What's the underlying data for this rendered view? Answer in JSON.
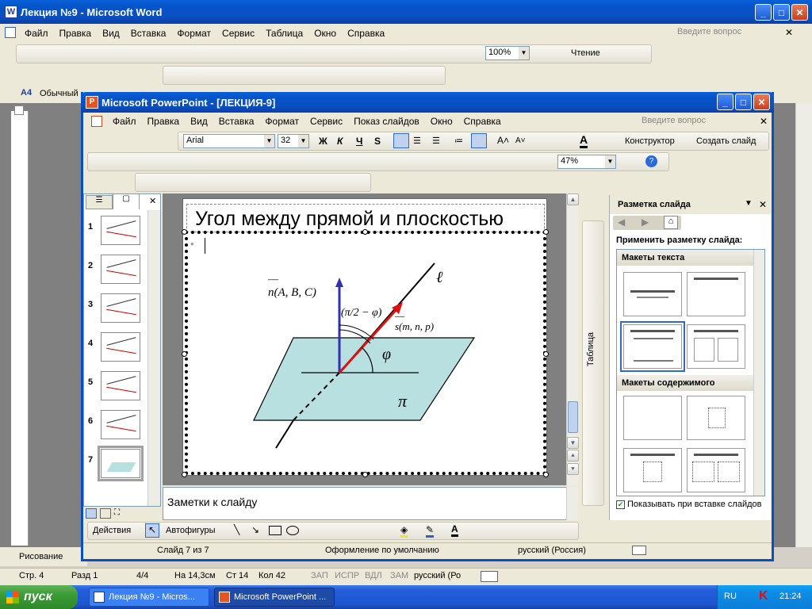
{
  "word": {
    "title": "Лекция №9 - Microsoft Word",
    "menu": [
      "Файл",
      "Правка",
      "Вид",
      "Вставка",
      "Формат",
      "Сервис",
      "Таблица",
      "Окно",
      "Справка"
    ],
    "ask_placeholder": "Введите вопрос",
    "zoom": "100%",
    "read_label": "Чтение",
    "style_value": "Обычный",
    "draw_label": "Рисование",
    "status": {
      "page": "Стр. 4",
      "section": "Разд 1",
      "pages": "4/4",
      "at": "На 14,3см",
      "line": "Ст 14",
      "col": "Кол 42",
      "rec": "ЗАП",
      "trk": "ИСПР",
      "ext": "ВДЛ",
      "ovr": "ЗАМ",
      "lang": "русский (Ро"
    }
  },
  "ppt": {
    "title": "Microsoft PowerPoint - [ЛЕКЦИЯ-9]",
    "menu": [
      "Файл",
      "Правка",
      "Вид",
      "Вставка",
      "Формат",
      "Сервис",
      "Показ слайдов",
      "Окно",
      "Справка"
    ],
    "ask_placeholder": "Введите вопрос",
    "font": "Arial",
    "font_size": "32",
    "designer_label": "Конструктор",
    "new_slide_label": "Создать слайд",
    "zoom": "47%",
    "slide_title": "Угол между прямой и плоскостью",
    "notes_placeholder": "Заметки к слайду",
    "actions_label": "Действия",
    "autoshapes_label": "Автофигуры",
    "status": {
      "slide": "Слайд 7 из 7",
      "design": "Оформление по умолчанию",
      "lang": "русский (Россия)"
    },
    "slides": [
      "1",
      "2",
      "3",
      "4",
      "5",
      "6",
      "7"
    ],
    "table_label": "Таблица"
  },
  "figure": {
    "normal_label": "n(A, B, C)",
    "normal_bar": "—",
    "dir_label": "s(m, n, p)",
    "dir_bar": "—",
    "complement_label": "(π/2 − φ)",
    "phi": "φ",
    "pi": "π",
    "line_label": "ℓ"
  },
  "taskpane": {
    "title": "Разметка слайда",
    "apply_label": "Применить разметку слайда:",
    "text_layouts": "Макеты текста",
    "content_layouts": "Макеты содержимого",
    "show_on_insert": "Показывать при вставке слайдов"
  },
  "taskbar": {
    "start": "пуск",
    "items": [
      "Лекция №9 - Micros...",
      "Microsoft PowerPoint ..."
    ],
    "lang": "RU",
    "clock": "21:24"
  },
  "colors": {
    "plane": "#b8e0e0",
    "normal": "#3030b0",
    "vector": "#e01010",
    "line": "#000000",
    "accent": "#316ac5"
  }
}
